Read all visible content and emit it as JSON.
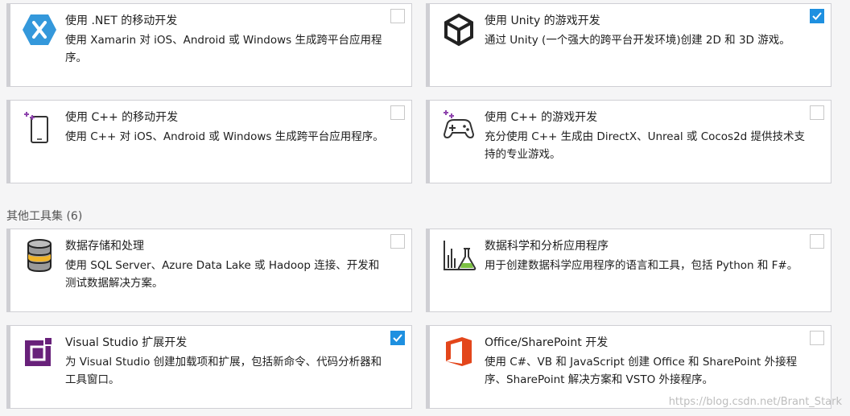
{
  "cards": [
    {
      "title": "使用 .NET 的移动开发",
      "desc": "使用 Xamarin 对 iOS、Android 或 Windows 生成跨平台应用程序。",
      "checked": false,
      "icon": "xamarin-icon"
    },
    {
      "title": "使用 Unity 的游戏开发",
      "desc": "通过 Unity (一个强大的跨平台开发环境)创建 2D 和 3D 游戏。",
      "checked": true,
      "icon": "unity-icon"
    },
    {
      "title": "使用 C++ 的移动开发",
      "desc": "使用 C++ 对 iOS、Android 或 Windows 生成跨平台应用程序。",
      "checked": false,
      "icon": "mobile-device-icon"
    },
    {
      "title": "使用 C++ 的游戏开发",
      "desc": "充分使用 C++ 生成由 DirectX、Unreal 或 Cocos2d 提供技术支持的专业游戏。",
      "checked": false,
      "icon": "gamepad-icon"
    },
    {
      "title": "数据存储和处理",
      "desc": "使用 SQL Server、Azure Data Lake 或 Hadoop 连接、开发和测试数据解决方案。",
      "checked": false,
      "icon": "database-icon"
    },
    {
      "title": "数据科学和分析应用程序",
      "desc": "用于创建数据科学应用程序的语言和工具，包括 Python 和 F#。",
      "checked": false,
      "icon": "data-science-icon"
    },
    {
      "title": "Visual Studio 扩展开发",
      "desc": "为 Visual Studio 创建加载项和扩展，包括新命令、代码分析器和工具窗口。",
      "checked": true,
      "icon": "extension-icon"
    },
    {
      "title": "Office/SharePoint 开发",
      "desc": "使用 C#、VB 和 JavaScript 创建 Office 和 SharePoint 外接程序、SharePoint 解决方案和 VSTO 外接程序。",
      "checked": false,
      "icon": "office-icon"
    }
  ],
  "section": {
    "title": "其他工具集",
    "count": "(6)"
  },
  "watermark": "https://blog.csdn.net/Brant_Stark",
  "colors": {
    "checkbox_checked": "#1e90e0",
    "border": "#cfcfd4"
  }
}
